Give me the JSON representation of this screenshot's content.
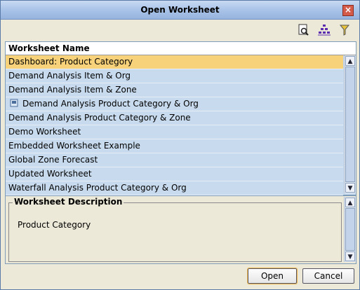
{
  "window": {
    "title": "Open Worksheet"
  },
  "toolbar": {
    "icons": [
      "find-icon",
      "hierarchy-icon",
      "filter-icon"
    ]
  },
  "list": {
    "header": "Worksheet Name",
    "rows": [
      {
        "label": "Dashboard: Product Category",
        "selected": true
      },
      {
        "label": "Demand Analysis Item & Org"
      },
      {
        "label": "Demand Analysis Item & Zone"
      },
      {
        "label": "Demand Analysis Product Category & Org",
        "icon": "worksheet-icon"
      },
      {
        "label": "Demand Analysis Product Category & Zone"
      },
      {
        "label": "Demo Worksheet"
      },
      {
        "label": "Embedded Worksheet Example"
      },
      {
        "label": "Global Zone Forecast"
      },
      {
        "label": "Updated Worksheet"
      },
      {
        "label": "Waterfall Analysis Product Category & Org"
      }
    ]
  },
  "description": {
    "legend": "Worksheet Description",
    "text": "Product Category"
  },
  "buttons": {
    "open": "Open",
    "cancel": "Cancel"
  },
  "colors": {
    "selected_row": "#f7d27a",
    "row": "#c8dbee",
    "titlebar": "#a9c3e8"
  }
}
